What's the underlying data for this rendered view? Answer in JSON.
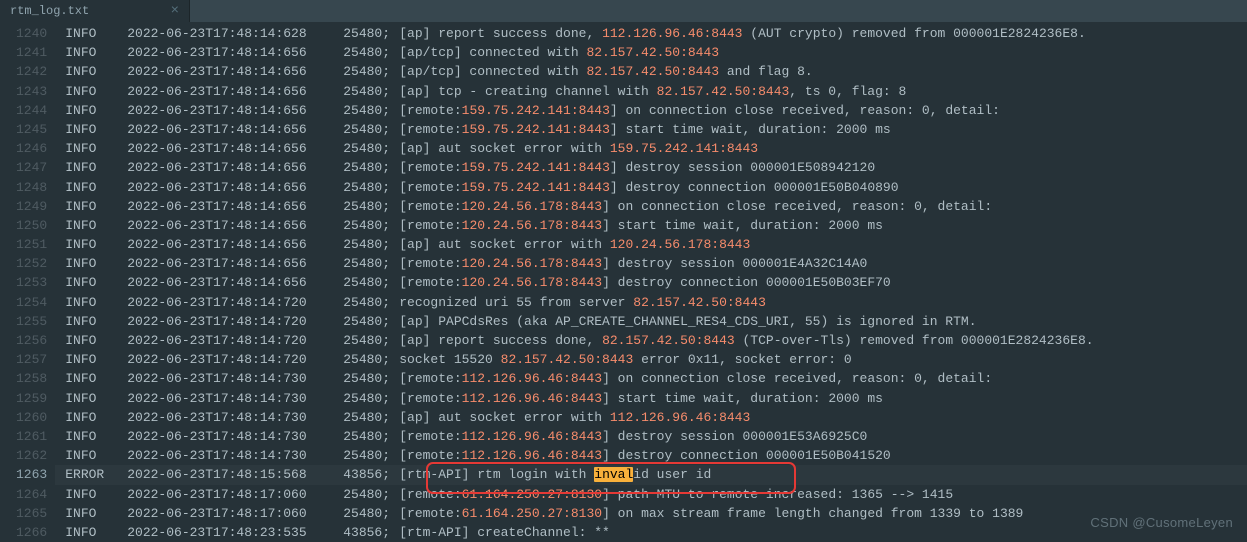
{
  "tab": {
    "title": "rtm_log.txt",
    "close": "×"
  },
  "lines": [
    {
      "ln": 1240,
      "lvl": "INFO",
      "ts": "2022-06-23T17:48:14:628",
      "pid": "25480;",
      "msg_pre": "[ap] report success done, ",
      "ip": "112.126.96.46:8443",
      "msg_post": " (AUT crypto) removed from 000001E2824236E8."
    },
    {
      "ln": 1241,
      "lvl": "INFO",
      "ts": "2022-06-23T17:48:14:656",
      "pid": "25480;",
      "msg_pre": "[ap/tcp] connected with ",
      "ip": "82.157.42.50:8443",
      "msg_post": ""
    },
    {
      "ln": 1242,
      "lvl": "INFO",
      "ts": "2022-06-23T17:48:14:656",
      "pid": "25480;",
      "msg_pre": "[ap/tcp] connected with ",
      "ip": "82.157.42.50:8443",
      "msg_post": " and flag 8."
    },
    {
      "ln": 1243,
      "lvl": "INFO",
      "ts": "2022-06-23T17:48:14:656",
      "pid": "25480;",
      "msg_pre": "[ap] tcp - creating channel with ",
      "ip": "82.157.42.50:8443",
      "msg_post": ", ts 0, flag: 8"
    },
    {
      "ln": 1244,
      "lvl": "INFO",
      "ts": "2022-06-23T17:48:14:656",
      "pid": "25480;",
      "msg_pre": "[remote:",
      "ip": "159.75.242.141:8443",
      "msg_post": "] on connection close received, reason: 0, detail:"
    },
    {
      "ln": 1245,
      "lvl": "INFO",
      "ts": "2022-06-23T17:48:14:656",
      "pid": "25480;",
      "msg_pre": "[remote:",
      "ip": "159.75.242.141:8443",
      "msg_post": "] start time wait, duration: 2000 ms"
    },
    {
      "ln": 1246,
      "lvl": "INFO",
      "ts": "2022-06-23T17:48:14:656",
      "pid": "25480;",
      "msg_pre": "[ap] aut socket error with ",
      "ip": "159.75.242.141:8443",
      "msg_post": ""
    },
    {
      "ln": 1247,
      "lvl": "INFO",
      "ts": "2022-06-23T17:48:14:656",
      "pid": "25480;",
      "msg_pre": "[remote:",
      "ip": "159.75.242.141:8443",
      "msg_post": "] destroy session 000001E508942120"
    },
    {
      "ln": 1248,
      "lvl": "INFO",
      "ts": "2022-06-23T17:48:14:656",
      "pid": "25480;",
      "msg_pre": "[remote:",
      "ip": "159.75.242.141:8443",
      "msg_post": "] destroy connection 000001E50B040890"
    },
    {
      "ln": 1249,
      "lvl": "INFO",
      "ts": "2022-06-23T17:48:14:656",
      "pid": "25480;",
      "msg_pre": "[remote:",
      "ip": "120.24.56.178:8443",
      "msg_post": "] on connection close received, reason: 0, detail:"
    },
    {
      "ln": 1250,
      "lvl": "INFO",
      "ts": "2022-06-23T17:48:14:656",
      "pid": "25480;",
      "msg_pre": "[remote:",
      "ip": "120.24.56.178:8443",
      "msg_post": "] start time wait, duration: 2000 ms"
    },
    {
      "ln": 1251,
      "lvl": "INFO",
      "ts": "2022-06-23T17:48:14:656",
      "pid": "25480;",
      "msg_pre": "[ap] aut socket error with ",
      "ip": "120.24.56.178:8443",
      "msg_post": ""
    },
    {
      "ln": 1252,
      "lvl": "INFO",
      "ts": "2022-06-23T17:48:14:656",
      "pid": "25480;",
      "msg_pre": "[remote:",
      "ip": "120.24.56.178:8443",
      "msg_post": "] destroy session 000001E4A32C14A0"
    },
    {
      "ln": 1253,
      "lvl": "INFO",
      "ts": "2022-06-23T17:48:14:656",
      "pid": "25480;",
      "msg_pre": "[remote:",
      "ip": "120.24.56.178:8443",
      "msg_post": "] destroy connection 000001E50B03EF70"
    },
    {
      "ln": 1254,
      "lvl": "INFO",
      "ts": "2022-06-23T17:48:14:720",
      "pid": "25480;",
      "msg_pre": "recognized uri 55 from server ",
      "ip": "82.157.42.50:8443",
      "msg_post": ""
    },
    {
      "ln": 1255,
      "lvl": "INFO",
      "ts": "2022-06-23T17:48:14:720",
      "pid": "25480;",
      "msg_pre": "[ap] PAPCdsRes (aka AP_CREATE_CHANNEL_RES4_CDS_URI, 55) is ignored in RTM.",
      "ip": "",
      "msg_post": ""
    },
    {
      "ln": 1256,
      "lvl": "INFO",
      "ts": "2022-06-23T17:48:14:720",
      "pid": "25480;",
      "msg_pre": "[ap] report success done, ",
      "ip": "82.157.42.50:8443",
      "msg_post": " (TCP-over-Tls) removed from 000001E2824236E8."
    },
    {
      "ln": 1257,
      "lvl": "INFO",
      "ts": "2022-06-23T17:48:14:720",
      "pid": "25480;",
      "msg_pre": "socket 15520 ",
      "ip": "82.157.42.50:8443",
      "msg_post": " error 0x11, socket error: 0"
    },
    {
      "ln": 1258,
      "lvl": "INFO",
      "ts": "2022-06-23T17:48:14:730",
      "pid": "25480;",
      "msg_pre": "[remote:",
      "ip": "112.126.96.46:8443",
      "msg_post": "] on connection close received, reason: 0, detail:"
    },
    {
      "ln": 1259,
      "lvl": "INFO",
      "ts": "2022-06-23T17:48:14:730",
      "pid": "25480;",
      "msg_pre": "[remote:",
      "ip": "112.126.96.46:8443",
      "msg_post": "] start time wait, duration: 2000 ms"
    },
    {
      "ln": 1260,
      "lvl": "INFO",
      "ts": "2022-06-23T17:48:14:730",
      "pid": "25480;",
      "msg_pre": "[ap] aut socket error with ",
      "ip": "112.126.96.46:8443",
      "msg_post": ""
    },
    {
      "ln": 1261,
      "lvl": "INFO",
      "ts": "2022-06-23T17:48:14:730",
      "pid": "25480;",
      "msg_pre": "[remote:",
      "ip": "112.126.96.46:8443",
      "msg_post": "] destroy session 000001E53A6925C0"
    },
    {
      "ln": 1262,
      "lvl": "INFO",
      "ts": "2022-06-23T17:48:14:730",
      "pid": "25480;",
      "msg_pre": "[remote:",
      "ip": "112.126.96.46:8443",
      "msg_post": "] destroy connection 000001E50B041520"
    },
    {
      "ln": 1263,
      "lvl": "ERROR",
      "ts": "2022-06-23T17:48:15:568",
      "pid": "43856;",
      "msg_pre": "[rtm-API] rtm login with ",
      "hl": "inval",
      "msg_post2": "id user id",
      "current": true
    },
    {
      "ln": 1264,
      "lvl": "INFO",
      "ts": "2022-06-23T17:48:17:060",
      "pid": "25480;",
      "msg_pre": "[remote:",
      "ip": "61.164.250.27:8130",
      "msg_post": "] path MTU to remote increased: 1365 --> 1415"
    },
    {
      "ln": 1265,
      "lvl": "INFO",
      "ts": "2022-06-23T17:48:17:060",
      "pid": "25480;",
      "msg_pre": "[remote:",
      "ip": "61.164.250.27:8130",
      "msg_post": "] on max stream frame length changed from 1339 to 1389"
    },
    {
      "ln": 1266,
      "lvl": "INFO",
      "ts": "2022-06-23T17:48:23:535",
      "pid": "43856;",
      "msg_pre": "[rtm-API] createChannel: **",
      "ip": "",
      "msg_post": ""
    }
  ],
  "watermark": "CSDN @CusomeLeyen"
}
